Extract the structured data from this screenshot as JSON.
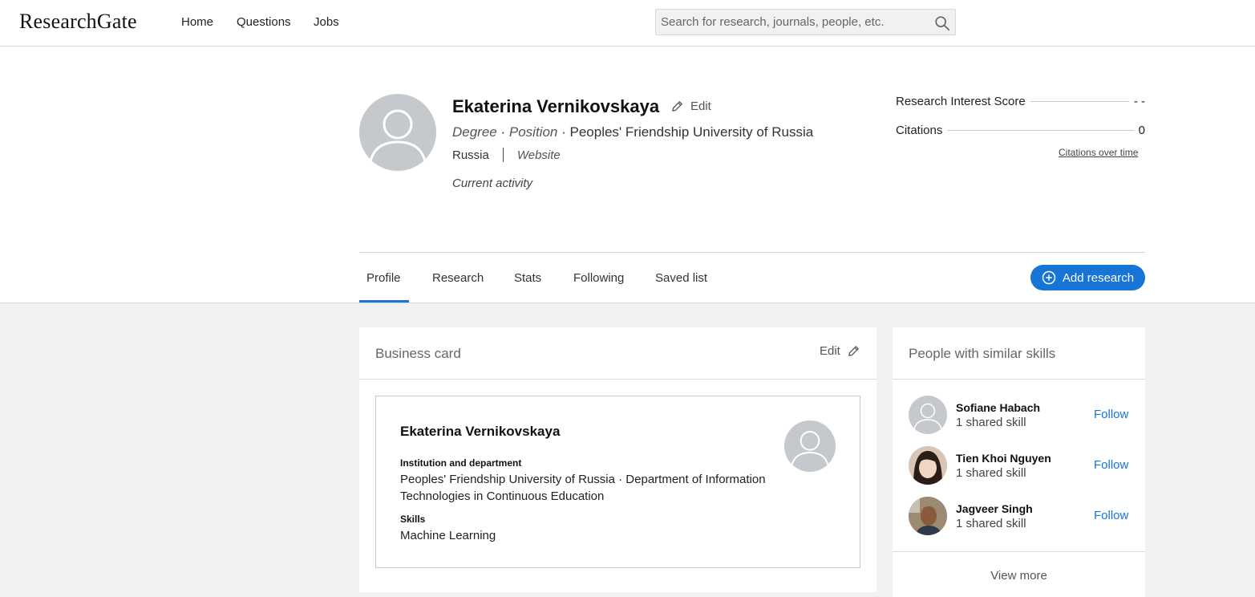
{
  "app": {
    "logo": "ResearchGate"
  },
  "nav": {
    "items": [
      "Home",
      "Questions",
      "Jobs"
    ]
  },
  "search": {
    "placeholder": "Search for research, journals, people, etc."
  },
  "profile": {
    "name": "Ekaterina Vernikovskaya",
    "edit_label": "Edit",
    "degree": "Degree",
    "position": "Position",
    "institution": "Peoples' Friendship University of Russia",
    "country": "Russia",
    "website": "Website",
    "current_activity": "Current activity"
  },
  "stats": {
    "ris_label": "Research Interest Score",
    "ris_value": "- -",
    "citations_label": "Citations",
    "citations_value": "0",
    "citations_over_time": "Citations over time"
  },
  "tabs": [
    {
      "label": "Profile",
      "active": true
    },
    {
      "label": "Research"
    },
    {
      "label": "Stats"
    },
    {
      "label": "Following"
    },
    {
      "label": "Saved list"
    }
  ],
  "add_research_label": "Add research",
  "business_card": {
    "title": "Business card",
    "edit_label": "Edit",
    "name": "Ekaterina Vernikovskaya",
    "institution_label": "Institution and department",
    "institution_value": "Peoples' Friendship University of Russia · Department of Information Technologies in Continuous Education",
    "skills_label": "Skills",
    "skills_value": "Machine Learning"
  },
  "similar": {
    "title": "People with similar skills",
    "people": [
      {
        "name": "Sofiane Habach",
        "sub": "1 shared skill",
        "follow": "Follow",
        "avatar": "placeholder"
      },
      {
        "name": "Tien Khoi Nguyen",
        "sub": "1 shared skill",
        "follow": "Follow",
        "avatar": "photo"
      },
      {
        "name": "Jagveer Singh",
        "sub": "1 shared skill",
        "follow": "Follow",
        "avatar": "photo"
      }
    ],
    "view_more": "View more"
  },
  "colors": {
    "accent": "#1775d8",
    "avatar_bg": "#c5c8cc"
  }
}
